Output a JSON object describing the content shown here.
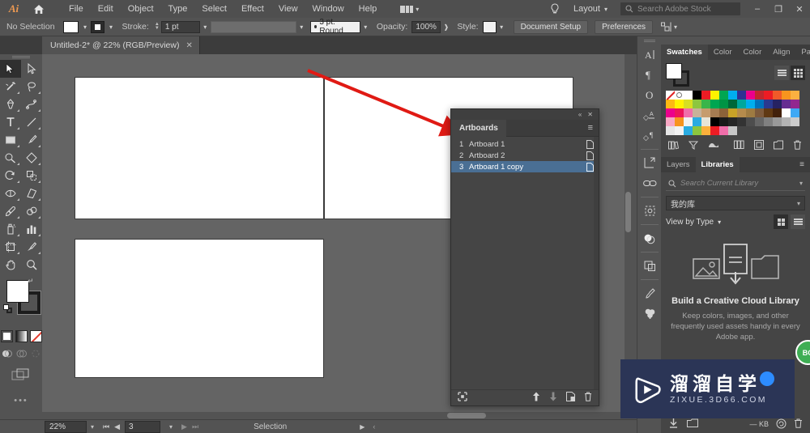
{
  "menubar": {
    "app_logo": "Ai",
    "home_icon": "home-icon",
    "items": [
      "File",
      "Edit",
      "Object",
      "Type",
      "Select",
      "Effect",
      "View",
      "Window",
      "Help"
    ],
    "arrange_label": "arrange-documents-icon",
    "bulb_icon": "lightbulb-icon",
    "layout_label": "Layout",
    "search_placeholder": "Search Adobe Stock",
    "minimize": "–",
    "restore": "❐",
    "close": "✕"
  },
  "controlbar": {
    "selection_status": "No Selection",
    "fill_color": "#ffffff",
    "stroke_label": "Stroke:",
    "stroke_weight": "1 pt",
    "variable_width_profile": "",
    "brush_definition": "3 pt. Round",
    "opacity_label": "Opacity:",
    "opacity_value": "100%",
    "style_label": "Style:",
    "document_setup": "Document Setup",
    "preferences": "Preferences",
    "align_icon": "align-to-icon"
  },
  "tab": {
    "title": "Untitled-2* @ 22% (RGB/Preview)",
    "close": "✕"
  },
  "toolbar": {
    "tools": [
      "selection-tool",
      "direct-selection-tool",
      "magic-wand-tool",
      "lasso-tool",
      "pen-tool",
      "curvature-tool",
      "type-tool",
      "line-segment-tool",
      "rectangle-tool",
      "paintbrush-tool",
      "shaper-tool",
      "shape-builder-tool",
      "rotate-tool",
      "scale-tool",
      "width-tool",
      "free-transform-tool",
      "eyedropper-tool",
      "blend-tool",
      "symbol-sprayer-tool",
      "column-graph-tool",
      "artboard-tool",
      "slice-tool",
      "hand-tool",
      "zoom-tool"
    ],
    "fill_color": "#ffffff",
    "stroke_color": "#1c1c1c",
    "color_modes": [
      "color-fill-mode",
      "gradient-fill-mode",
      "none-fill-mode"
    ],
    "draw_modes": [
      "draw-normal",
      "draw-behind",
      "draw-inside"
    ],
    "screen_mode": "change-screen-mode",
    "more_tools": "•••"
  },
  "canvas": {
    "artboards": [
      {
        "name": "Artboard 1"
      },
      {
        "name": "Artboard 2"
      },
      {
        "name": "Artboard 1 copy"
      }
    ],
    "annotation": "red-arrow-annotation"
  },
  "artboards_panel": {
    "collapse_icon": "«",
    "close_icon": "✕",
    "tab_label": "Artboards",
    "menu_icon": "panel-menu-icon",
    "rows": [
      {
        "num": "1",
        "name": "Artboard 1",
        "selected": false
      },
      {
        "num": "2",
        "name": "Artboard 2",
        "selected": false
      },
      {
        "num": "3",
        "name": "Artboard 1 copy",
        "selected": true
      }
    ],
    "footer": {
      "rearrange": "rearrange-all-artboards-icon",
      "move_up": "move-up-icon",
      "move_down": "move-down-icon",
      "new_artboard": "new-artboard-icon",
      "delete_artboard": "delete-artboard-icon"
    }
  },
  "icon_dock": {
    "icons": [
      "character-panel-icon",
      "paragraph-panel-icon",
      "opentype-panel-icon",
      "character-styles-panel-icon",
      "paragraph-styles-panel-icon",
      "transform-panel-icon",
      "links-panel-icon",
      "image-trace-panel-icon",
      "transparency-panel-icon",
      "artboards-panel-icon",
      "brushes-panel-icon",
      "symbols-panel-icon"
    ]
  },
  "swatches_panel": {
    "tabs": [
      "Swatches",
      "Color",
      "Color",
      "Align",
      "Pathfi"
    ],
    "active_tab": "Swatches",
    "menu_icon": "panel-menu-icon",
    "fill_color": "#ffffff",
    "stroke_color": "#1c1c1c",
    "view_list_icon": "list-view-icon",
    "view_grid_icon": "grid-view-icon",
    "colors": [
      "none",
      "registration",
      "#ffffff",
      "#000000",
      "#ed1c24",
      "#fff200",
      "#00a651",
      "#00aeef",
      "#2e3192",
      "#ec008c",
      "#c1272d",
      "#ed1c24",
      "#f15a29",
      "#f7941e",
      "#fbb040",
      "#fdb913",
      "#fff200",
      "#d7df23",
      "#8dc63f",
      "#39b54a",
      "#00a651",
      "#009444",
      "#006838",
      "#00a79d",
      "#00aeef",
      "#0072bc",
      "#2b3990",
      "#262262",
      "#662d91",
      "#92278f",
      "#ec008c",
      "#ed145b",
      "#f06eaa",
      "#c7b299",
      "#c69c6d",
      "#a67c52",
      "#8c6239",
      "#c9a227",
      "#b58b4c",
      "#9e7b42",
      "#7d5a3c",
      "#603913",
      "#42210b",
      "#ffffff",
      "#3fa9f5",
      "#f7a8c4",
      "#f7941e",
      "#f2f2f2",
      "#29abe2",
      "#e7e5d8",
      "#000000",
      "#1a1a1a",
      "#262626",
      "#333333",
      "#4d4d4d",
      "#666666",
      "#808080",
      "#999999",
      "#b3b3b3",
      "#cccccc",
      "#e6e6e6",
      "#f2f2f2",
      "#29abe2",
      "#8cc63f",
      "#fbb03b",
      "#ed1c24",
      "#f06eaa",
      "#c7c7c7"
    ],
    "footer_icons": [
      "swatch-libraries-icon",
      "show-swatch-kinds-icon",
      "swatch-options-icon",
      "color-group-icon",
      "new-color-group-icon",
      "new-swatch-icon",
      "delete-swatch-icon"
    ]
  },
  "libraries_panel": {
    "tabs": [
      "Layers",
      "Libraries"
    ],
    "active_tab": "Libraries",
    "menu_icon": "panel-menu-icon",
    "search_placeholder": "Search Current Library",
    "search_icon": "search-icon",
    "library_name": "我的库",
    "view_label": "View by Type",
    "grid_view_icon": "grid-view-icon",
    "list_view_icon": "list-view-icon",
    "empty_title": "Build a Creative Cloud Library",
    "empty_body": "Keep colors, images, and other frequently used assets handy in every Adobe app.",
    "footer": {
      "add_icon": "add-content-icon",
      "libraries_icon": "libraries-icon",
      "size_label": "— KB",
      "sync_icon": "sync-icon",
      "delete_icon": "delete-icon"
    }
  },
  "statusbar": {
    "zoom": "22%",
    "first_icon": "first-artboard-icon",
    "prev_icon": "previous-artboard-icon",
    "page": "3",
    "next_icon": "next-artboard-icon",
    "last_icon": "last-artboard-icon",
    "status_text": "Selection"
  },
  "watermark": {
    "play_icon": "play-logo-icon",
    "cn_text": "溜溜自学",
    "en_text": "ZIXUE.3D66.COM",
    "badge": "BO"
  },
  "theme": {
    "panel_bg": "#454545",
    "chrome_bg": "#535353",
    "canvas_bg": "#646464",
    "selection_blue": "#4a6f94",
    "accent_orange": "#ef9a52",
    "annotation_red": "#e02020"
  }
}
